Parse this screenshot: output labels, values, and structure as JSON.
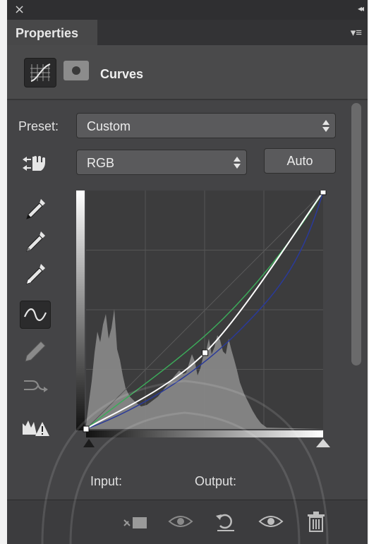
{
  "window": {
    "close_glyph": "×",
    "collapse_glyph": "◂◂"
  },
  "tab": {
    "label": "Properties",
    "menu_glyph": "▾≡"
  },
  "header": {
    "title": "Curves"
  },
  "preset": {
    "label": "Preset:",
    "value": "Custom"
  },
  "channel": {
    "value": "RGB"
  },
  "auto_button": {
    "label": "Auto"
  },
  "io": {
    "input_label": "Input:",
    "output_label": "Output:"
  },
  "tools": [
    "curve-adjust-hand-icon",
    "sample-black-eyedropper-icon",
    "sample-gray-eyedropper-icon",
    "sample-white-eyedropper-icon",
    "edit-points-curve-icon",
    "draw-pencil-icon",
    "smooth-curve-icon",
    "clipping-warning-icon"
  ],
  "bottom_icons": [
    "clip-to-layer-icon",
    "view-previous-state-icon",
    "reset-icon",
    "toggle-visibility-icon",
    "delete-icon"
  ],
  "colors": {
    "panel_bg": "#444446",
    "curve_white": "#ffffff",
    "curve_green": "#3cab5a",
    "curve_blue": "#2a3a9a",
    "histogram": "#8a8a8a"
  },
  "curve": {
    "input_range": [
      0,
      255
    ],
    "output_range": [
      0,
      255
    ],
    "points": [
      [
        0,
        0
      ],
      [
        128,
        82
      ],
      [
        255,
        255
      ]
    ]
  }
}
